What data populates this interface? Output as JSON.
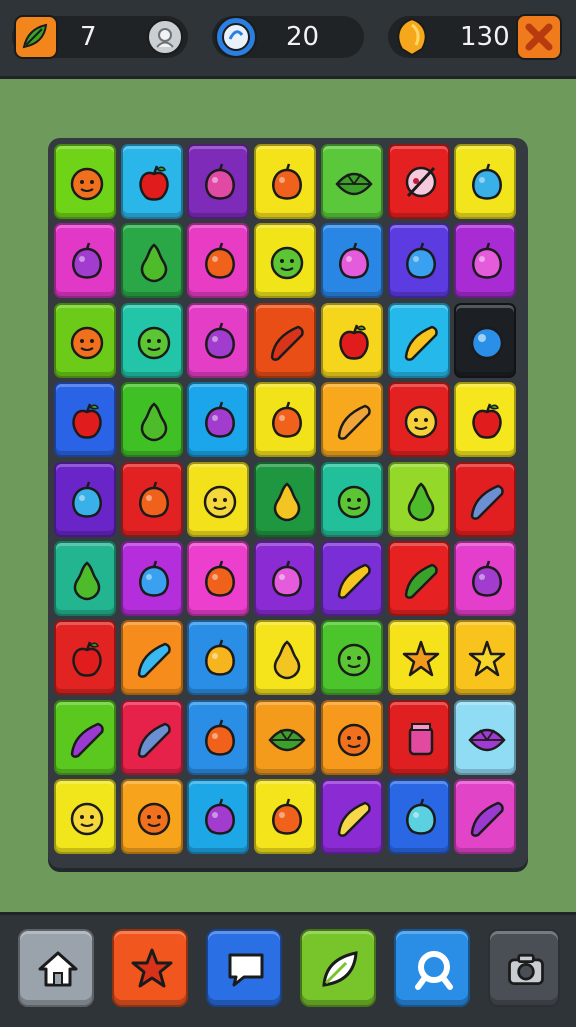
{
  "hud": {
    "leaves_count": "7",
    "moves_count": "20",
    "coins_count": "130",
    "icons": [
      "leaf-icon",
      "settings-gear-icon",
      "timer-orb-icon",
      "gold-coin-icon",
      "close-icon"
    ]
  },
  "board": {
    "rows": [
      [
        {
          "color": "#6fd317",
          "fruit": "orange-face"
        },
        {
          "color": "#2ab6e9",
          "fruit": "red-apple"
        },
        {
          "color": "#7d2bb8",
          "fruit": "pink-mushroom"
        },
        {
          "color": "#f4e21b",
          "fruit": "orange-fruit"
        },
        {
          "color": "#5bc83b",
          "fruit": "green-leaf"
        },
        {
          "color": "#e42020",
          "fruit": "pink-skull"
        },
        {
          "color": "#f2e51c",
          "fruit": "blue-bird"
        }
      ],
      [
        {
          "color": "#e238c8",
          "fruit": "purple-plum"
        },
        {
          "color": "#2aa848",
          "fruit": "green-pear"
        },
        {
          "color": "#e83cc4",
          "fruit": "orange-fruit"
        },
        {
          "color": "#f1e51a",
          "fruit": "green-face"
        },
        {
          "color": "#2a86e4",
          "fruit": "pink-berry"
        },
        {
          "color": "#5c3be0",
          "fruit": "blue-drop"
        },
        {
          "color": "#a82bd4",
          "fruit": "pink-berry"
        }
      ],
      [
        {
          "color": "#6ccb18",
          "fruit": "orange-face"
        },
        {
          "color": "#22c5a8",
          "fruit": "green-face"
        },
        {
          "color": "#e43ec7",
          "fruit": "purple-plum"
        },
        {
          "color": "#e84e15",
          "fruit": "red-carrot"
        },
        {
          "color": "#f5d61c",
          "fruit": "red-apple"
        },
        {
          "color": "#25b8ea",
          "fruit": "yellow-banana"
        },
        {
          "color": "#1c2024",
          "fruit": "blue-ball"
        }
      ],
      [
        {
          "color": "#2a63e6",
          "fruit": "red-apple"
        },
        {
          "color": "#3fc126",
          "fruit": "green-pear"
        },
        {
          "color": "#1ba5ea",
          "fruit": "purple-plum"
        },
        {
          "color": "#f2e21a",
          "fruit": "orange-fruit"
        },
        {
          "color": "#f7a81d",
          "fruit": "orange-carrot"
        },
        {
          "color": "#e32120",
          "fruit": "yellow-cat"
        },
        {
          "color": "#f5e61d",
          "fruit": "red-apple"
        }
      ],
      [
        {
          "color": "#6a25c8",
          "fruit": "blue-bird"
        },
        {
          "color": "#e22222",
          "fruit": "orange-fruit"
        },
        {
          "color": "#f3e11b",
          "fruit": "yellow-face"
        },
        {
          "color": "#1f9640",
          "fruit": "yellow-pear"
        },
        {
          "color": "#22c09a",
          "fruit": "green-face"
        },
        {
          "color": "#94d92a",
          "fruit": "green-pear"
        },
        {
          "color": "#e21f20",
          "fruit": "candy-bar"
        }
      ],
      [
        {
          "color": "#23b58f",
          "fruit": "green-pear"
        },
        {
          "color": "#b52edb",
          "fruit": "blue-drop"
        },
        {
          "color": "#ec3fcd",
          "fruit": "orange-fruit"
        },
        {
          "color": "#8a2bd4",
          "fruit": "pink-berry"
        },
        {
          "color": "#7a2ed6",
          "fruit": "yellow-banana"
        },
        {
          "color": "#e52121",
          "fruit": "green-cucumber"
        },
        {
          "color": "#e43fcc",
          "fruit": "purple-plum"
        }
      ],
      [
        {
          "color": "#e12321",
          "fruit": "red-apple"
        },
        {
          "color": "#f58c1c",
          "fruit": "blue-candy"
        },
        {
          "color": "#2a8ee6",
          "fruit": "yellow-lemon"
        },
        {
          "color": "#f5e31b",
          "fruit": "yellow-pear"
        },
        {
          "color": "#4cc42b",
          "fruit": "green-face"
        },
        {
          "color": "#f5e21b",
          "fruit": "orange-urchin"
        },
        {
          "color": "#f7c31c",
          "fruit": "yellow-star"
        }
      ],
      [
        {
          "color": "#5bc81f",
          "fruit": "purple-eggplant"
        },
        {
          "color": "#e7224a",
          "fruit": "candy-bar"
        },
        {
          "color": "#2a8ee6",
          "fruit": "orange-fruit"
        },
        {
          "color": "#f59b1c",
          "fruit": "green-leaf"
        },
        {
          "color": "#f7991c",
          "fruit": "orange-face"
        },
        {
          "color": "#e02020",
          "fruit": "pink-jar"
        },
        {
          "color": "#8fdcf4",
          "fruit": "purple-flower"
        }
      ],
      [
        {
          "color": "#f1e61c",
          "fruit": "yellow-face"
        },
        {
          "color": "#f7a41c",
          "fruit": "orange-face"
        },
        {
          "color": "#1ea7e6",
          "fruit": "purple-plum"
        },
        {
          "color": "#f4e41b",
          "fruit": "orange-fruit"
        },
        {
          "color": "#8b2bd4",
          "fruit": "candy-stick"
        },
        {
          "color": "#2a67e4",
          "fruit": "teal-drop"
        },
        {
          "color": "#e244c8",
          "fruit": "purple-eggplant"
        }
      ]
    ]
  },
  "nav": {
    "buttons": [
      {
        "name": "home-button",
        "icon": "home-icon",
        "color": "#9aa3ab"
      },
      {
        "name": "star-button",
        "icon": "star-icon",
        "color": "#f2561f"
      },
      {
        "name": "chat-button",
        "icon": "chat-bubble-icon",
        "color": "#2a6fe3"
      },
      {
        "name": "leaf-button",
        "icon": "leaf-icon",
        "color": "#77c52b"
      },
      {
        "name": "search-button",
        "icon": "magnifier-icon",
        "color": "#2a8ee6"
      },
      {
        "name": "camera-button",
        "icon": "camera-icon",
        "color": "#4a4f55"
      }
    ]
  }
}
